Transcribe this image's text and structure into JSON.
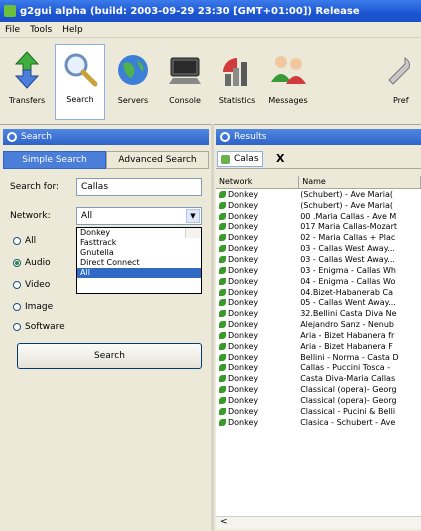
{
  "window": {
    "title": "g2gui alpha (build: 2003-09-29 23:30 [GMT+01:00]) Release"
  },
  "menu": [
    "File",
    "Tools",
    "Help"
  ],
  "toolbar": [
    {
      "label": "Transfers",
      "icon": "transfers-arrows-icon"
    },
    {
      "label": "Search",
      "icon": "search-magnifier-icon"
    },
    {
      "label": "Servers",
      "icon": "servers-globe-icon"
    },
    {
      "label": "Console",
      "icon": "console-icon"
    },
    {
      "label": "Statistics",
      "icon": "statistics-icon"
    },
    {
      "label": "Messages",
      "icon": "messages-icon"
    },
    {
      "label": "Pref",
      "icon": "preferences-icon"
    }
  ],
  "search_panel": {
    "header": "Search",
    "tab_simple": "Simple Search",
    "tab_advanced": "Advanced Search",
    "search_for_label": "Search for:",
    "search_for_value": "Callas",
    "network_label": "Network:",
    "network_selected": "All",
    "network_options": [
      "Donkey",
      "Fasttrack",
      "Gnutella",
      "Direct Connect",
      "All"
    ],
    "media_types": [
      {
        "label": "All",
        "selected": false
      },
      {
        "label": "Audio",
        "selected": true
      },
      {
        "label": "Video",
        "selected": false
      },
      {
        "label": "Image",
        "selected": false
      },
      {
        "label": "Software",
        "selected": false
      }
    ],
    "search_button": "Search"
  },
  "results_panel": {
    "header": "Results",
    "tab_label": "Calas",
    "close_label": "X",
    "columns": [
      "Network",
      "Name"
    ],
    "rows": [
      {
        "network": "Donkey",
        "name": "(Schubert) - Ave Maria("
      },
      {
        "network": "Donkey",
        "name": "(Schubert) - Ave Maria("
      },
      {
        "network": "Donkey",
        "name": "00 .Maria Callas - Ave M"
      },
      {
        "network": "Donkey",
        "name": "017 Maria Callas-Mozart"
      },
      {
        "network": "Donkey",
        "name": "02 - Maria Callas + Plac"
      },
      {
        "network": "Donkey",
        "name": "03 - Callas West Away..."
      },
      {
        "network": "Donkey",
        "name": "03 - Callas West Away..."
      },
      {
        "network": "Donkey",
        "name": "03 - Enigma - Callas Wh"
      },
      {
        "network": "Donkey",
        "name": "04 - Enigma - Callas Wo"
      },
      {
        "network": "Donkey",
        "name": "04.Bizet-Habanerab Ca"
      },
      {
        "network": "Donkey",
        "name": "05 - Callas Went Away..."
      },
      {
        "network": "Donkey",
        "name": "32.Bellini Casta Diva Ne"
      },
      {
        "network": "Donkey",
        "name": "Alejandro Sanz - Nenub"
      },
      {
        "network": "Donkey",
        "name": "Aria - Bizet Habanera fr"
      },
      {
        "network": "Donkey",
        "name": "Aria - Bizet Habanera F"
      },
      {
        "network": "Donkey",
        "name": "Bellini - Norma - Casta D"
      },
      {
        "network": "Donkey",
        "name": "Callas - Puccini Tosca -"
      },
      {
        "network": "Donkey",
        "name": "Casta Diva-Maria Callas"
      },
      {
        "network": "Donkey",
        "name": "Classical (opera)- Georg"
      },
      {
        "network": "Donkey",
        "name": "Classical (opera)- Georg"
      },
      {
        "network": "Donkey",
        "name": "Classical - Pucini & Belli"
      },
      {
        "network": "Donkey",
        "name": "Clasica - Schubert - Ave"
      }
    ],
    "hscroll_arrow": "<"
  },
  "colors": {
    "title_bar": "#1d55d2",
    "panel_header": "#2e63c9",
    "network_icon": "#3a9a2a"
  }
}
